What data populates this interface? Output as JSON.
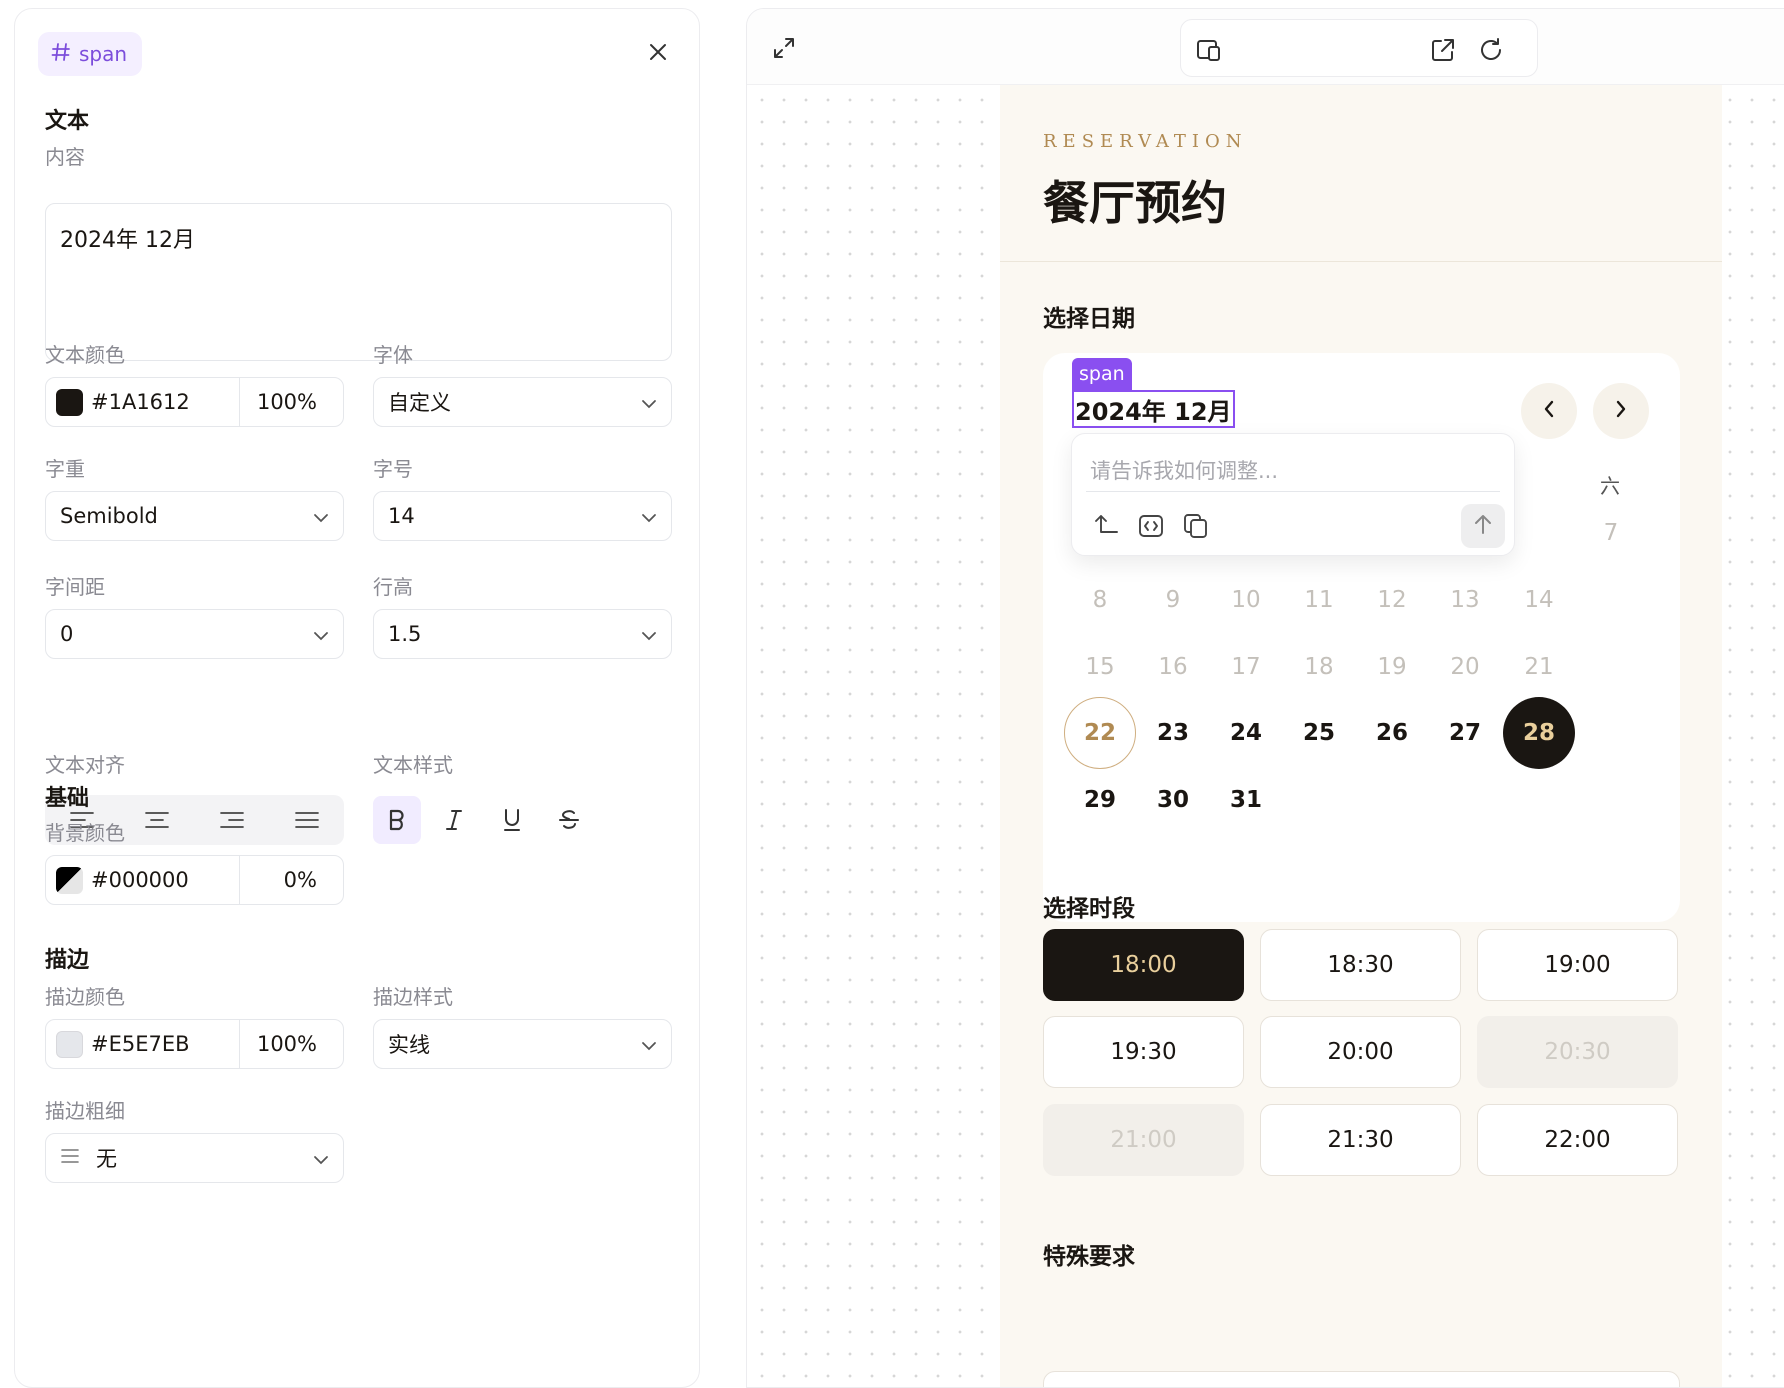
{
  "inspector": {
    "tag": "span",
    "sections": {
      "text": "文本",
      "basic": "基础",
      "stroke": "描边"
    },
    "content_label": "内容",
    "content_value": "2024年 12月",
    "text_color": {
      "label": "文本颜色",
      "hex": "#1A1612",
      "opacity": "100%",
      "swatch": "#1A1612"
    },
    "font_family": {
      "label": "字体",
      "value": "自定义"
    },
    "font_weight": {
      "label": "字重",
      "value": "Semibold"
    },
    "font_size": {
      "label": "字号",
      "value": "14"
    },
    "letter_spacing": {
      "label": "字间距",
      "value": "0"
    },
    "line_height": {
      "label": "行高",
      "value": "1.5"
    },
    "text_align": {
      "label": "文本对齐"
    },
    "text_style": {
      "label": "文本样式"
    },
    "bg_color": {
      "label": "背景颜色",
      "hex": "#000000",
      "opacity": "0%"
    },
    "stroke_color": {
      "label": "描边颜色",
      "hex": "#E5E7EB",
      "opacity": "100%",
      "swatch": "#E5E7EB"
    },
    "stroke_style": {
      "label": "描边样式",
      "value": "实线"
    },
    "stroke_width": {
      "label": "描边粗细",
      "value": "无"
    }
  },
  "preview": {
    "kicker": "RESERVATION",
    "title": "餐厅预约",
    "date_heading": "选择日期",
    "selected_tag": "span",
    "month": "2024年 12月",
    "weekday_sat": "六",
    "ai_placeholder": "请告诉我如何调整...",
    "days": {
      "d7": "7",
      "d8": "8",
      "d9": "9",
      "d10": "10",
      "d11": "11",
      "d12": "12",
      "d13": "13",
      "d14": "14",
      "d15": "15",
      "d16": "16",
      "d17": "17",
      "d18": "18",
      "d19": "19",
      "d20": "20",
      "d21": "21",
      "d22": "22",
      "d23": "23",
      "d24": "24",
      "d25": "25",
      "d26": "26",
      "d27": "27",
      "d28": "28",
      "d29": "29",
      "d30": "30",
      "d31": "31"
    },
    "time_heading": "选择时段",
    "slots": {
      "s1": "18:00",
      "s2": "18:30",
      "s3": "19:00",
      "s4": "19:30",
      "s5": "20:00",
      "s6": "20:30",
      "s7": "21:00",
      "s8": "21:30",
      "s9": "22:00"
    },
    "special_heading": "特殊要求"
  }
}
